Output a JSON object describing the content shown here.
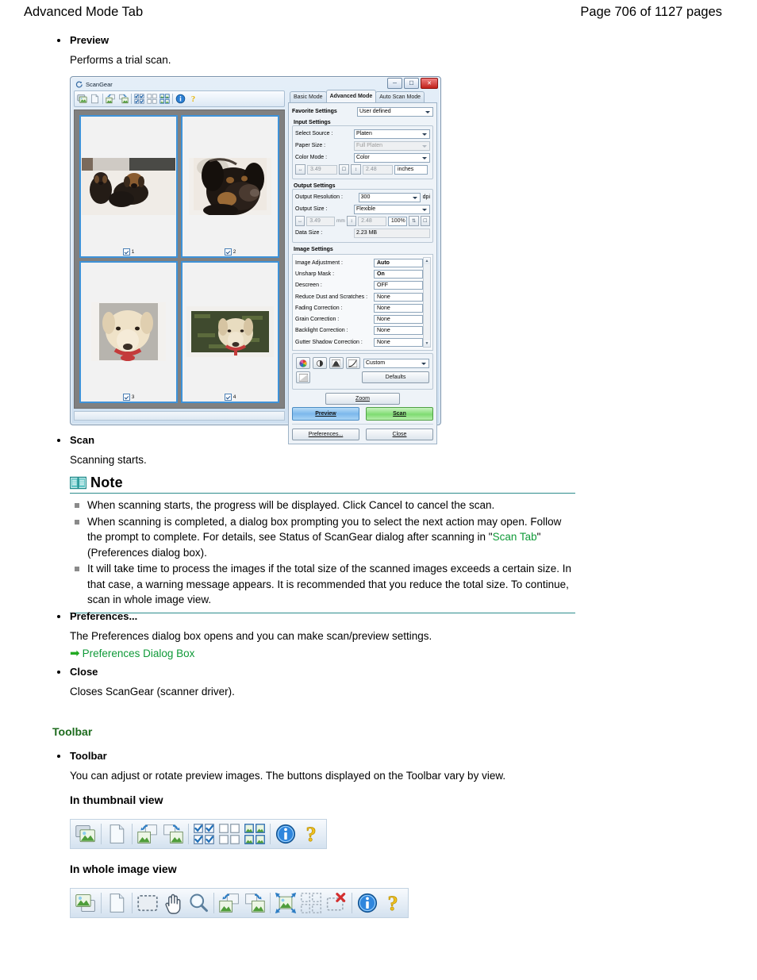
{
  "page_header": {
    "left_title": "Advanced Mode Tab",
    "right_title": "Page 706 of 1127 pages"
  },
  "sections": {
    "preview": {
      "title": "Preview",
      "body": "Performs a trial scan."
    },
    "scan": {
      "title": "Scan",
      "body": "Scanning starts."
    },
    "note": {
      "title": "Note",
      "items": [
        "When scanning starts, the progress will be displayed. Click Cancel to cancel the scan.",
        "When scanning is completed, a dialog box prompting you to select the next action may open. Follow the prompt to complete. For details, see Status of ScanGear dialog after scanning in \"",
        "It will take time to process the images if the total size of the scanned images exceeds a certain size. In that case, a warning message appears. It is recommended that you reduce the total size. To continue, scan in whole image view."
      ],
      "item2_link": "Scan Tab",
      "item2_tail": "\" (Preferences dialog box)."
    },
    "preferences": {
      "title": "Preferences...",
      "body": "The Preferences dialog box opens and you can make scan/preview settings.",
      "link": "Preferences Dialog Box"
    },
    "close": {
      "title": "Close",
      "body": "Closes ScanGear (scanner driver)."
    },
    "toolbar_section": {
      "heading": "Toolbar",
      "title": "Toolbar",
      "body": "You can adjust or rotate preview images. The buttons displayed on the Toolbar vary by view.",
      "thumbnail_view_label": "In thumbnail view",
      "whole_image_view_label": "In whole image view"
    }
  },
  "scangear": {
    "window_title": "ScanGear",
    "window_controls": {
      "minimize": "minimize-icon",
      "maximize": "maximize-icon",
      "close": "close-icon"
    },
    "toolbar_icons": [
      "auto-crop-icon",
      "clear-icon",
      "rotate-left-icon",
      "rotate-right-icon",
      "select-all-frames-icon",
      "clear-all-frames-icon",
      "select-all-images-icon",
      "information-icon",
      "help-icon"
    ],
    "tabs": [
      {
        "label": "Basic Mode",
        "active": false
      },
      {
        "label": "Advanced Mode",
        "active": true
      },
      {
        "label": "Auto Scan Mode",
        "active": false
      }
    ],
    "favorite_settings": {
      "label": "Favorite Settings",
      "value": "User defined"
    },
    "input_settings": {
      "group_title": "Input Settings",
      "rows": [
        {
          "label": "Select Source :",
          "value": "Platen",
          "disabled": false
        },
        {
          "label": "Paper Size :",
          "value": "Full Platen",
          "disabled": true
        },
        {
          "label": "Color Mode :",
          "value": "Color",
          "disabled": false
        }
      ],
      "width_value": "3.49",
      "height_value": "2.48",
      "unit_value": "inches",
      "width_icon": "width-icon",
      "height_icon": "height-icon",
      "lock_icon": "aspect-lock-icon"
    },
    "output_settings": {
      "group_title": "Output Settings",
      "resolution_label": "Output Resolution :",
      "resolution_value": "300",
      "resolution_unit": "dpi",
      "size_label": "Output Size :",
      "size_value": "Flexible",
      "width_value": "3.49",
      "height_value": "2.48",
      "scale_value": "100%",
      "unit_between": "mm",
      "data_size_label": "Data Size :",
      "data_size_value": "2.23 MB"
    },
    "image_settings": {
      "group_title": "Image Settings",
      "rows": [
        {
          "label": "Image Adjustment :",
          "value": "Auto",
          "bold": true
        },
        {
          "label": "Unsharp Mask :",
          "value": "On",
          "bold": true
        },
        {
          "label": "Descreen :",
          "value": "OFF",
          "bold": false
        },
        {
          "label": "Reduce Dust and Scratches :",
          "value": "None",
          "bold": false
        },
        {
          "label": "Fading Correction :",
          "value": "None",
          "bold": false
        },
        {
          "label": "Grain Correction :",
          "value": "None",
          "bold": false
        },
        {
          "label": "Backlight Correction :",
          "value": "None",
          "bold": false
        },
        {
          "label": "Gutter Shadow Correction :",
          "value": "None",
          "bold": false
        }
      ]
    },
    "color_adjust": {
      "buttons": [
        "color-palette-icon",
        "brightness-contrast-icon",
        "histogram-icon",
        "tone-curve-icon",
        "final-review-icon"
      ],
      "preset_value": "Custom",
      "defaults_label": "Defaults"
    },
    "action_buttons": {
      "zoom": "Zoom",
      "preview": "Preview",
      "scan": "Scan",
      "preferences": "Preferences...",
      "close": "Close"
    },
    "thumbnails": [
      {
        "number": "1",
        "checked": true,
        "caption": "two dachshund puppies"
      },
      {
        "number": "2",
        "checked": true,
        "caption": "dachshund close-up portrait"
      },
      {
        "number": "3",
        "checked": true,
        "caption": "labrador with red leash"
      },
      {
        "number": "4",
        "checked": true,
        "caption": "labrador on grass"
      }
    ]
  },
  "toolbar_thumbnail_view": {
    "icons": [
      "whole-image-view-icon",
      "clear-icon",
      "rotate-left-icon",
      "rotate-right-icon",
      "select-all-frames-icon",
      "clear-all-frames-icon",
      "select-all-images-icon",
      "information-icon",
      "help-icon"
    ]
  },
  "toolbar_whole_image_view": {
    "icons": [
      "thumbnail-view-icon",
      "clear-icon",
      "crop-icon",
      "hand-icon",
      "zoom-icon",
      "rotate-left-icon",
      "rotate-right-icon",
      "auto-crop-icon",
      "multi-crop-icon",
      "remove-crop-icon",
      "information-icon",
      "help-icon"
    ]
  },
  "colors": {
    "link_green": "#0f9a38",
    "heading_green": "#1d6b1d",
    "note_teal": "#2d8c8c",
    "preview_button_blue": "#7cb8ec",
    "scan_button_green": "#7fdc72"
  }
}
